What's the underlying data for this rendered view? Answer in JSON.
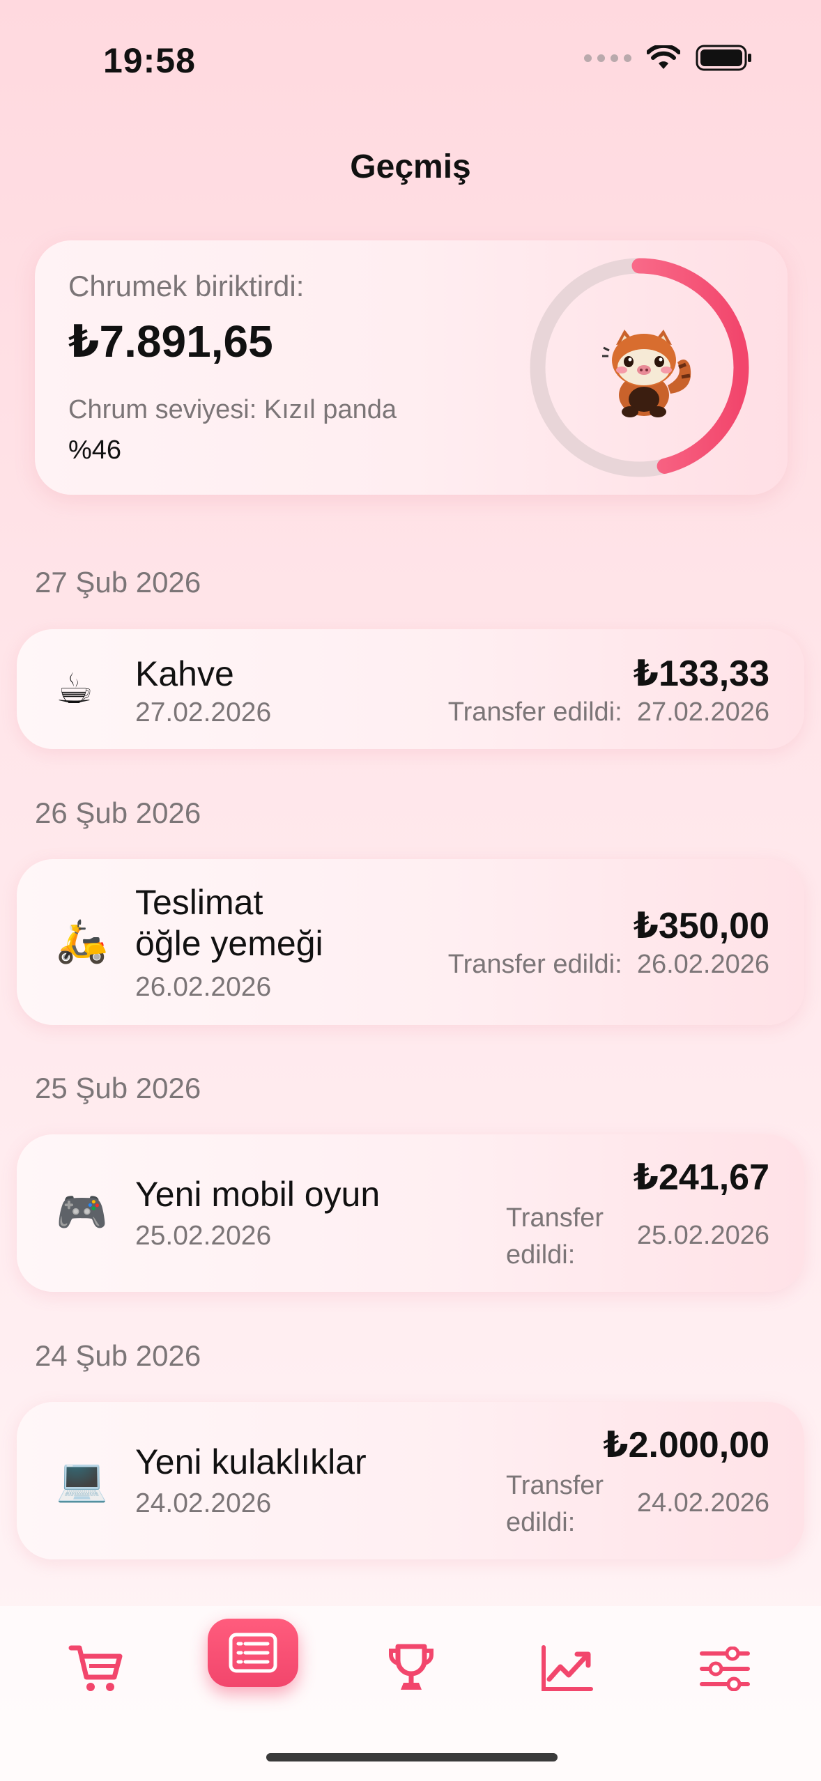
{
  "status_bar": {
    "time": "19:58"
  },
  "page": {
    "title": "Geçmiş"
  },
  "summary": {
    "label": "Chrumek biriktirdi:",
    "amount": "₺7.891,65",
    "level_text": "Chrum seviyesi: Kızıl panda",
    "progress_text": "%46",
    "progress": 0.46,
    "accent_color": "#f2466c"
  },
  "history": [
    {
      "date_header": "27 Şub 2026",
      "item": {
        "icon": "coffee-icon",
        "emoji": "☕",
        "title": "Kahve",
        "date": "27.02.2026",
        "amount": "₺133,33",
        "transfer_label": "Transfer edildi:",
        "transfer_date": "27.02.2026"
      }
    },
    {
      "date_header": "26 Şub 2026",
      "item": {
        "icon": "scooter-icon",
        "emoji": "🛵",
        "title_line1": "Teslimat",
        "title_line2": "öğle yemeği",
        "date": "26.02.2026",
        "amount": "₺350,00",
        "transfer_label": "Transfer edildi:",
        "transfer_date": "26.02.2026"
      }
    },
    {
      "date_header": "25 Şub 2026",
      "item": {
        "icon": "gamepad-icon",
        "emoji": "🎮",
        "title": "Yeni mobil oyun",
        "date": "25.02.2026",
        "amount": "₺241,67",
        "transfer_line1": "Transfer",
        "transfer_line2": "edildi:",
        "transfer_date": "25.02.2026"
      }
    },
    {
      "date_header": "24 Şub 2026",
      "item": {
        "icon": "laptop-icon",
        "emoji": "💻",
        "title": "Yeni kulaklıklar",
        "date": "24.02.2026",
        "amount": "₺2.000,00",
        "transfer_line1": "Transfer",
        "transfer_line2": "edildi:",
        "transfer_date": "24.02.2026"
      }
    }
  ],
  "tab_bar": {
    "tabs": [
      "cart-icon",
      "history-icon",
      "trophy-icon",
      "chart-icon",
      "settings-sliders-icon"
    ],
    "active": "history-icon"
  }
}
